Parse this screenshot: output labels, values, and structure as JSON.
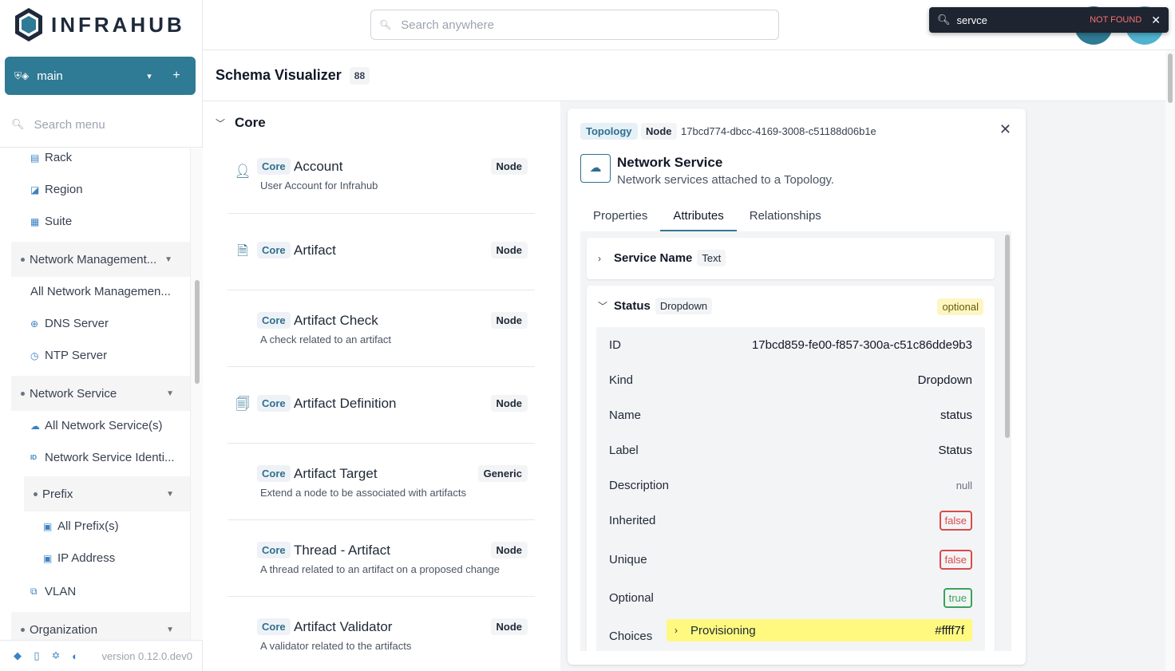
{
  "brand": {
    "name": "INFRAHUB"
  },
  "branch": {
    "name": "main",
    "chevron": "▾",
    "add": "+"
  },
  "sidebar": {
    "search_placeholder": "Search menu",
    "items": [
      {
        "label": "Rack",
        "icon": "rack-icon"
      },
      {
        "label": "Region",
        "icon": "region-icon"
      },
      {
        "label": "Suite",
        "icon": "suite-icon"
      },
      {
        "label": "Network Management...",
        "group": true
      },
      {
        "label": "All Network Managemen..."
      },
      {
        "label": "DNS Server",
        "icon": "dns-icon"
      },
      {
        "label": "NTP Server",
        "icon": "ntp-icon"
      },
      {
        "label": "Network Service",
        "group": true
      },
      {
        "label": "All Network Service(s)",
        "icon": "cloud-network-icon"
      },
      {
        "label": "Network Service Identi...",
        "icon": "id-icon"
      },
      {
        "label": "Prefix",
        "group": true
      },
      {
        "label": "All Prefix(s)",
        "icon": "prefix-icon"
      },
      {
        "label": "IP Address",
        "icon": "ip-icon"
      },
      {
        "label": "VLAN",
        "icon": "vlan-icon"
      },
      {
        "label": "Organization",
        "group": true
      }
    ],
    "version": "version 0.12.0.dev0"
  },
  "header": {
    "search_placeholder": "Search anywhere",
    "find": {
      "query": "servce",
      "status": "NOT FOUND"
    }
  },
  "page": {
    "title": "Schema Visualizer",
    "count": "88"
  },
  "schema": {
    "section": "Core",
    "items": [
      {
        "ns": "Core",
        "name": "Account",
        "kind": "Node",
        "desc": "User Account for Infrahub"
      },
      {
        "ns": "Core",
        "name": "Artifact",
        "kind": "Node",
        "desc": ""
      },
      {
        "ns": "Core",
        "name": "Artifact Check",
        "kind": "Node",
        "desc": "A check related to an artifact"
      },
      {
        "ns": "Core",
        "name": "Artifact Definition",
        "kind": "Node",
        "desc": ""
      },
      {
        "ns": "Core",
        "name": "Artifact Target",
        "kind": "Generic",
        "desc": "Extend a node to be associated with artifacts"
      },
      {
        "ns": "Core",
        "name": "Thread - Artifact",
        "kind": "Node",
        "desc": "A thread related to an artifact on a proposed change"
      },
      {
        "ns": "Core",
        "name": "Artifact Validator",
        "kind": "Node",
        "desc": "A validator related to the artifacts"
      }
    ]
  },
  "detail": {
    "namespace": "Topology",
    "kind": "Node",
    "id": "17bcd774-dbcc-4169-3008-c51188d06b1e",
    "title": "Network Service",
    "description": "Network services attached to a Topology.",
    "tabs": [
      "Properties",
      "Attributes",
      "Relationships"
    ],
    "attributes": [
      {
        "name": "Service Name",
        "type": "Text"
      },
      {
        "name": "Status",
        "type": "Dropdown",
        "badge": "optional"
      }
    ],
    "status_props": {
      "id_label": "ID",
      "id": "17bcd859-fe00-f857-300a-c51c86dde9b3",
      "kind_label": "Kind",
      "kind": "Dropdown",
      "name_label": "Name",
      "name": "status",
      "label_label": "Label",
      "label": "Status",
      "description_label": "Description",
      "description": "null",
      "inherited_label": "Inherited",
      "inherited": "false",
      "unique_label": "Unique",
      "unique": "false",
      "optional_label": "Optional",
      "optional": "true",
      "choices_label": "Choices",
      "choice": {
        "name": "Provisioning",
        "color": "#ffff7f"
      }
    }
  },
  "colors": {
    "accent": "#2f7a94",
    "choice_highlight": "#ffff7f"
  }
}
